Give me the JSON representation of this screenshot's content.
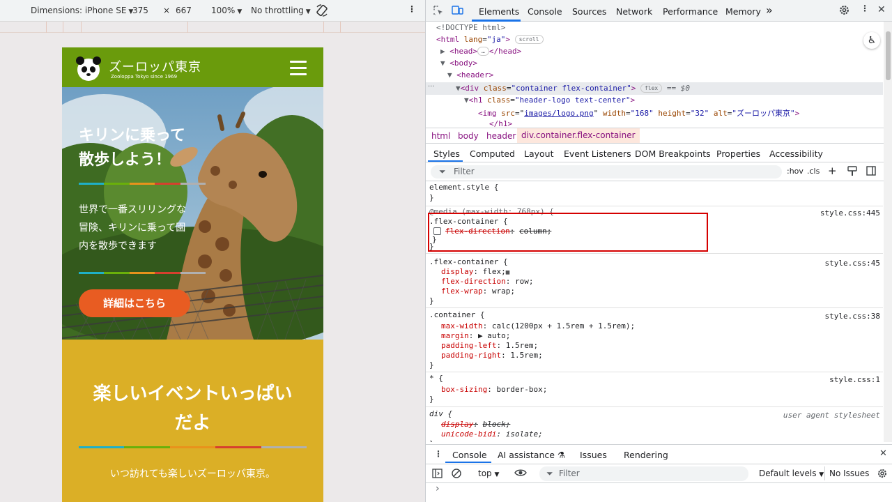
{
  "device_toolbar": {
    "dimensions_label": "Dimensions: iPhone SE",
    "width": "375",
    "times": "×",
    "height": "667",
    "zoom": "100%",
    "throttling": "No throttling"
  },
  "site": {
    "logo_title": "ズーロッパ東京",
    "logo_sub": "Zooloppa Tokyo since 1969",
    "hero_title_1": "キリンに乗って",
    "hero_title_2": "散歩しよう！",
    "hero_body_1": "世界で一番スリリングな",
    "hero_body_2": "冒険、キリンに乗って園",
    "hero_body_3": "内を散歩できます",
    "hero_button": "詳細はこちら",
    "event_title_1": "楽しいイベントいっぱい",
    "event_title_2": "だよ",
    "event_sub": "いつ訪れても楽しいズーロッパ東京。",
    "stripe_colors": [
      "#1fb0c8",
      "#6ab00a",
      "#e8921c",
      "#d6402e",
      "#b0b0b0"
    ]
  },
  "devtools": {
    "tabs": [
      "Elements",
      "Console",
      "Sources",
      "Network",
      "Performance",
      "Memory"
    ],
    "more_tabs": "»",
    "dom": {
      "doctype": "<!DOCTYPE html>",
      "html_open_tag": "<html",
      "html_lang_attr": "lang",
      "html_lang_val": "\"ja\"",
      "html_close": ">",
      "scroll_pill": "scroll",
      "head_open": "<head>",
      "head_ellipsis": "…",
      "head_close": "</head>",
      "body_open": "<body>",
      "header_open": "<header>",
      "div_open": "<div",
      "div_class_attr": "class",
      "div_class_val": "\"container flex-container\"",
      "div_close": ">",
      "flex_pill": "flex",
      "dollar": "== $0",
      "h1_open": "<h1",
      "h1_class_attr": "class",
      "h1_class_val": "\"header-logo text-center\"",
      "h1_close": ">",
      "img_open": "<img",
      "img_src_attr": "src",
      "img_src_val": "images/logo.png",
      "img_width_attr": "width",
      "img_width_val": "\"168\"",
      "img_height_attr": "height",
      "img_height_val": "\"32\"",
      "img_alt_attr": "alt",
      "img_alt_val": "\"ズーロッパ東京\"",
      "img_close": ">",
      "h1_end": "</h1>",
      "dots": "···"
    },
    "breadcrumbs": [
      "html",
      "body",
      "header",
      "div.container.flex-container"
    ],
    "subtabs": [
      "Styles",
      "Computed",
      "Layout",
      "Event Listeners",
      "DOM Breakpoints",
      "Properties",
      "Accessibility"
    ],
    "filter_placeholder": "Filter",
    "hov": ":hov",
    "cls": ".cls",
    "rules": {
      "element_style": "element.style {",
      "close": "}",
      "media": "@media (max-width: 768px) {",
      "flex1_selector": ".flex-container {",
      "flex1_prop": "flex-direction",
      "flex1_val": "column;",
      "flex1_src": "style.css:445",
      "flex2_selector": ".flex-container {",
      "flex2_src": "style.css:45",
      "flex2_p1": "display",
      "flex2_v1": "flex;",
      "flex2_p2": "flex-direction",
      "flex2_v2": "row;",
      "flex2_p3": "flex-wrap",
      "flex2_v3": "wrap;",
      "container_selector": ".container {",
      "container_src": "style.css:38",
      "c_p1": "max-width",
      "c_v1": "calc(1200px + 1.5rem + 1.5rem);",
      "c_p2": "margin",
      "c_v2": "▶ auto;",
      "c_p3": "padding-left",
      "c_v3": "1.5rem;",
      "c_p4": "padding-right",
      "c_v4": "1.5rem;",
      "star_selector": "* {",
      "star_src": "style.css:1",
      "s_p1": "box-sizing",
      "s_v1": "border-box;",
      "div_selector": "div {",
      "div_src": "user agent stylesheet",
      "d_p1": "display",
      "d_v1": "block;",
      "d_p2": "unicode-bidi",
      "d_v2": "isolate;",
      "colon": ":"
    },
    "drawer": {
      "tabs": [
        "Console",
        "AI assistance",
        "Issues",
        "Rendering"
      ],
      "context": "top",
      "filter_placeholder": "Filter",
      "levels": "Default levels",
      "issues": "No Issues",
      "prompt": "›"
    }
  }
}
